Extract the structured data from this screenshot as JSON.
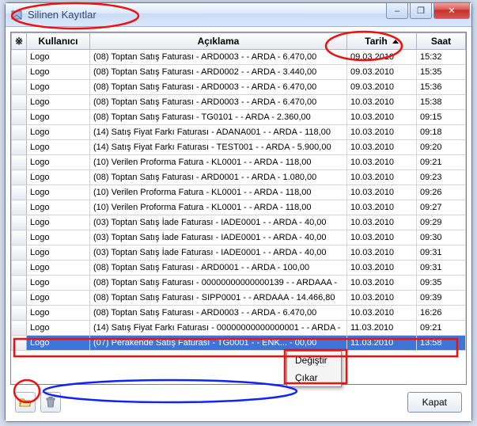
{
  "window": {
    "title": "Silinen Kayıtlar"
  },
  "window_buttons": {
    "minimize": "–",
    "maximize": "❐",
    "close": "✕"
  },
  "columns": {
    "corner": "※",
    "user": "Kullanıcı",
    "desc": "Açıklama",
    "date": "Tarih",
    "time": "Saat"
  },
  "rows": [
    {
      "user": "Logo",
      "desc": "(08) Toptan Satış Faturası - ARD0003 -  - ARDA - 6.470,00",
      "date": "09.03.2010",
      "time": "15:32"
    },
    {
      "user": "Logo",
      "desc": "(08) Toptan Satış Faturası - ARD0002 -  - ARDA - 3.440,00",
      "date": "09.03.2010",
      "time": "15:35"
    },
    {
      "user": "Logo",
      "desc": "(08) Toptan Satış Faturası - ARD0003 -  - ARDA - 6.470,00",
      "date": "09.03.2010",
      "time": "15:36"
    },
    {
      "user": "Logo",
      "desc": "(08) Toptan Satış Faturası - ARD0003 -  - ARDA - 6.470,00",
      "date": "10.03.2010",
      "time": "15:38"
    },
    {
      "user": "Logo",
      "desc": "(08) Toptan Satış Faturası - TG0101 -  - ARDA - 2.360,00",
      "date": "10.03.2010",
      "time": "09:15"
    },
    {
      "user": "Logo",
      "desc": "(14) Satış Fiyat Farkı Faturası - ADANA001 -  - ARDA - 118,00",
      "date": "10.03.2010",
      "time": "09:18"
    },
    {
      "user": "Logo",
      "desc": "(14) Satış Fiyat Farkı Faturası - TEST001 -  - ARDA - 5.900,00",
      "date": "10.03.2010",
      "time": "09:20"
    },
    {
      "user": "Logo",
      "desc": "(10) Verilen Proforma Fatura - KL0001 -  - ARDA - 118,00",
      "date": "10.03.2010",
      "time": "09:21"
    },
    {
      "user": "Logo",
      "desc": "(08) Toptan Satış Faturası - ARD0001 -  - ARDA - 1.080,00",
      "date": "10.03.2010",
      "time": "09:23"
    },
    {
      "user": "Logo",
      "desc": "(10) Verilen Proforma Fatura - KL0001 -  - ARDA - 118,00",
      "date": "10.03.2010",
      "time": "09:26"
    },
    {
      "user": "Logo",
      "desc": "(10) Verilen Proforma Fatura - KL0001 -  - ARDA - 118,00",
      "date": "10.03.2010",
      "time": "09:27"
    },
    {
      "user": "Logo",
      "desc": "(03) Toptan Satış İade Faturası - IADE0001 -  - ARDA - 40,00",
      "date": "10.03.2010",
      "time": "09:29"
    },
    {
      "user": "Logo",
      "desc": "(03) Toptan Satış İade Faturası - IADE0001 -  - ARDA - 40,00",
      "date": "10.03.2010",
      "time": "09:30"
    },
    {
      "user": "Logo",
      "desc": "(03) Toptan Satış İade Faturası - IADE0001 -  - ARDA - 40,00",
      "date": "10.03.2010",
      "time": "09:31"
    },
    {
      "user": "Logo",
      "desc": "(08) Toptan Satış Faturası - ARD0001 -  - ARDA - 100,00",
      "date": "10.03.2010",
      "time": "09:31"
    },
    {
      "user": "Logo",
      "desc": "(08) Toptan Satış Faturası - 00000000000000139 -  - ARDAAA - ",
      "date": "10.03.2010",
      "time": "09:35"
    },
    {
      "user": "Logo",
      "desc": "(08) Toptan Satış Faturası - SIPP0001 -  - ARDAAA - 14.466,80",
      "date": "10.03.2010",
      "time": "09:39"
    },
    {
      "user": "Logo",
      "desc": "(08) Toptan Satış Faturası - ARD0003 -  - ARDA - 6.470,00",
      "date": "10.03.2010",
      "time": "16:26"
    },
    {
      "user": "Logo",
      "desc": "(14) Satış Fiyat Farkı Faturası - 00000000000000001 -  - ARDA - ",
      "date": "11.03.2010",
      "time": "09:21"
    },
    {
      "user": "Logo",
      "desc": "(07) Perakende Satış Faturası - TG0001 -  - ENK... - 00,00",
      "date": "11.03.2010",
      "time": "13:58"
    }
  ],
  "selected_index": 19,
  "context_menu": {
    "edit": "Değiştir",
    "remove": "Çıkar"
  },
  "footer": {
    "close": "Kapat"
  },
  "icons": {
    "folder": "folder-open-icon",
    "trash": "trash-icon"
  }
}
